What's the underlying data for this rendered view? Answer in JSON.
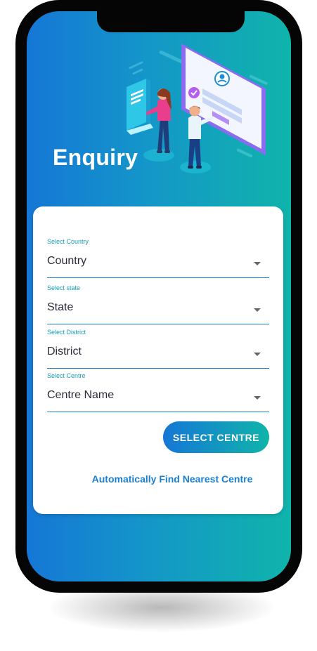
{
  "header": {
    "title": "Enquiry"
  },
  "form": {
    "fields": [
      {
        "label": "Select Country",
        "value": "Country"
      },
      {
        "label": "Select state",
        "value": "State"
      },
      {
        "label": "Select District",
        "value": "District"
      },
      {
        "label": "Select Centre",
        "value": "Centre Name"
      }
    ],
    "submit_label": "SELECT CENTRE",
    "find_nearest_label": "Automatically Find Nearest Centre"
  },
  "colors": {
    "gradient_start": "#1577d6",
    "gradient_end": "#10b4ab",
    "label_accent": "#14a0b8",
    "link": "#1a7fd0"
  }
}
